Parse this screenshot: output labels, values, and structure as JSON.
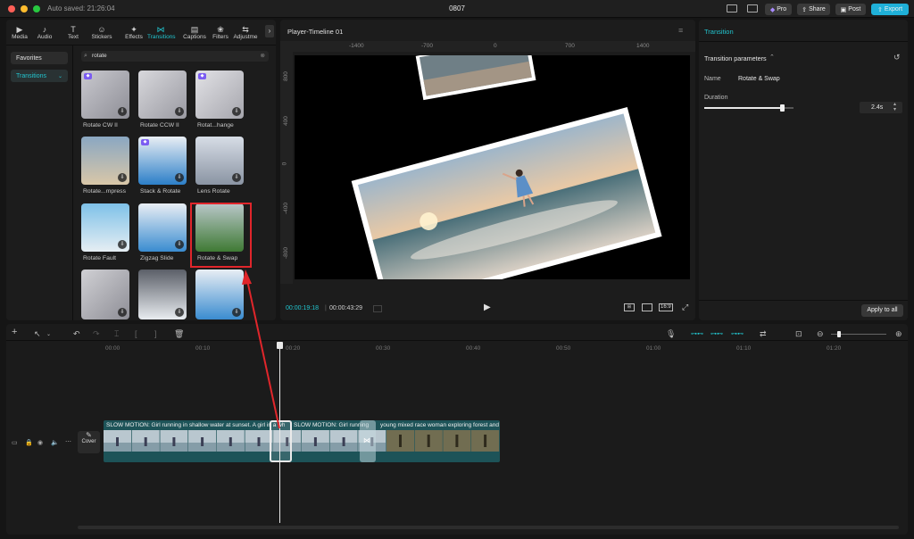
{
  "window": {
    "autosaved": "Auto saved: 21:26:04",
    "title": "0807"
  },
  "topbar": {
    "pro": "Pro",
    "share": "Share",
    "post": "Post",
    "export": "Export"
  },
  "toolbar": {
    "tabs": [
      {
        "label": "Media",
        "icon": "media-icon"
      },
      {
        "label": "Audio",
        "icon": "audio-icon"
      },
      {
        "label": "Text",
        "icon": "text-icon"
      },
      {
        "label": "Stickers",
        "icon": "stickers-icon"
      },
      {
        "label": "Effects",
        "icon": "effects-icon"
      },
      {
        "label": "Transitions",
        "icon": "transitions-icon"
      },
      {
        "label": "Captions",
        "icon": "captions-icon"
      },
      {
        "label": "Filters",
        "icon": "filters-icon"
      },
      {
        "label": "Adjustme",
        "icon": "adjustment-icon"
      }
    ]
  },
  "sidebar": {
    "favorites": "Favorites",
    "transitions": "Transitions"
  },
  "search": {
    "value": "rotate"
  },
  "effects": [
    "Rotate CW II",
    "Rotate CCW II",
    "Rotat...hange",
    "Rotate...mpress",
    "Stack & Rotate",
    "Lens Rotate",
    "Rotate Fault",
    "Zigzag Slide",
    "Rotate & Swap"
  ],
  "player": {
    "title": "Player-Timeline 01",
    "current_time": "00:00:19:18",
    "total_time": "00:00:43:29",
    "ruler_h": [
      "-1400",
      "-700",
      "0",
      "700",
      "1400"
    ],
    "ruler_v": [
      "800",
      "400",
      "0",
      "-400",
      "-800"
    ],
    "ratio": "16:9"
  },
  "inspector": {
    "tab": "Transition",
    "section": "Transition parameters",
    "name_label": "Name",
    "name_value": "Rotate & Swap",
    "duration_label": "Duration",
    "duration_value": "2.4s",
    "duration_fraction": 0.87,
    "apply_all": "Apply to all"
  },
  "timeline": {
    "ticks": [
      "00:00",
      "00:10",
      "00:20",
      "00:30",
      "00:40",
      "00:50",
      "01:00",
      "01:10",
      "01:20"
    ],
    "cover_label": "Cover",
    "clip1": "SLOW MOTION: Girl running in shallow water at sunset. A girl in a wh",
    "clip2": "SLOW MOTION: Girl running",
    "clip3": "young mixed race woman exploring forest and",
    "zoom_fraction": 0.12
  },
  "colors": {
    "accent": "#22c5cf",
    "selection": "#e0262b",
    "arrow": "#e0262b",
    "export": "#1fb0d8",
    "pro": "#7b5cf2"
  }
}
